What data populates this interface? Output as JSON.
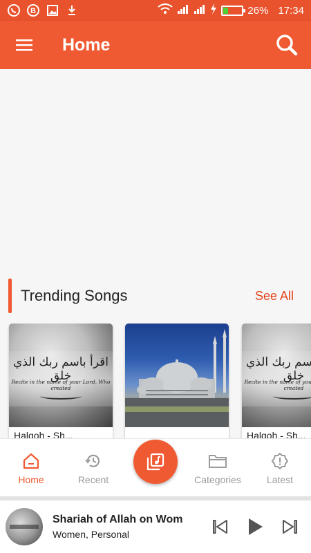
{
  "status_bar": {
    "battery_percent": "26%",
    "time": "17:34",
    "battery_level": 0.26,
    "left_icons": [
      "whatsapp-icon",
      "b-badge-icon",
      "image-icon",
      "download-icon"
    ],
    "right_icons": [
      "wifi-icon",
      "signal-icon",
      "signal-icon",
      "charging-icon",
      "battery-icon"
    ]
  },
  "app_bar": {
    "title": "Home",
    "menu_icon": "hamburger-menu-icon",
    "search_icon": "search-icon"
  },
  "trending": {
    "title": "Trending Songs",
    "see_all": "See All",
    "cards": [
      {
        "title": "Halqoh - Sh...",
        "image": "quran-calligraphy",
        "script_text": "اقرأ باسم ربك الذي خلق",
        "caption": "Recite in the name of your Lord, Who created"
      },
      {
        "title": "",
        "image": "mosque"
      },
      {
        "title": "Halqoh - Sh...",
        "image": "quran-calligraphy",
        "script_text": "اقرأ باسم ربك الذي خلق",
        "caption": "Recite in the name of your Lord, Who created"
      }
    ]
  },
  "bottom_nav": {
    "items": [
      {
        "label": "Home",
        "icon": "home-icon",
        "active": true
      },
      {
        "label": "Recent",
        "icon": "history-icon",
        "active": false
      },
      {
        "label": "Categories",
        "icon": "folder-icon",
        "active": false
      },
      {
        "label": "Latest",
        "icon": "badge-alert-icon",
        "active": false
      }
    ],
    "fab_icon": "music-library-icon"
  },
  "player": {
    "title": "Shariah of Allah on Wom",
    "subtitle": "Women, Personal",
    "prev_icon": "skip-previous-icon",
    "play_icon": "play-icon",
    "next_icon": "skip-next-icon"
  },
  "colors": {
    "primary": "#f05a32",
    "status_bar": "#e8522c",
    "accent_text": "#e3441c",
    "inactive": "#9b9b9b",
    "battery_fill": "#4cd137"
  }
}
